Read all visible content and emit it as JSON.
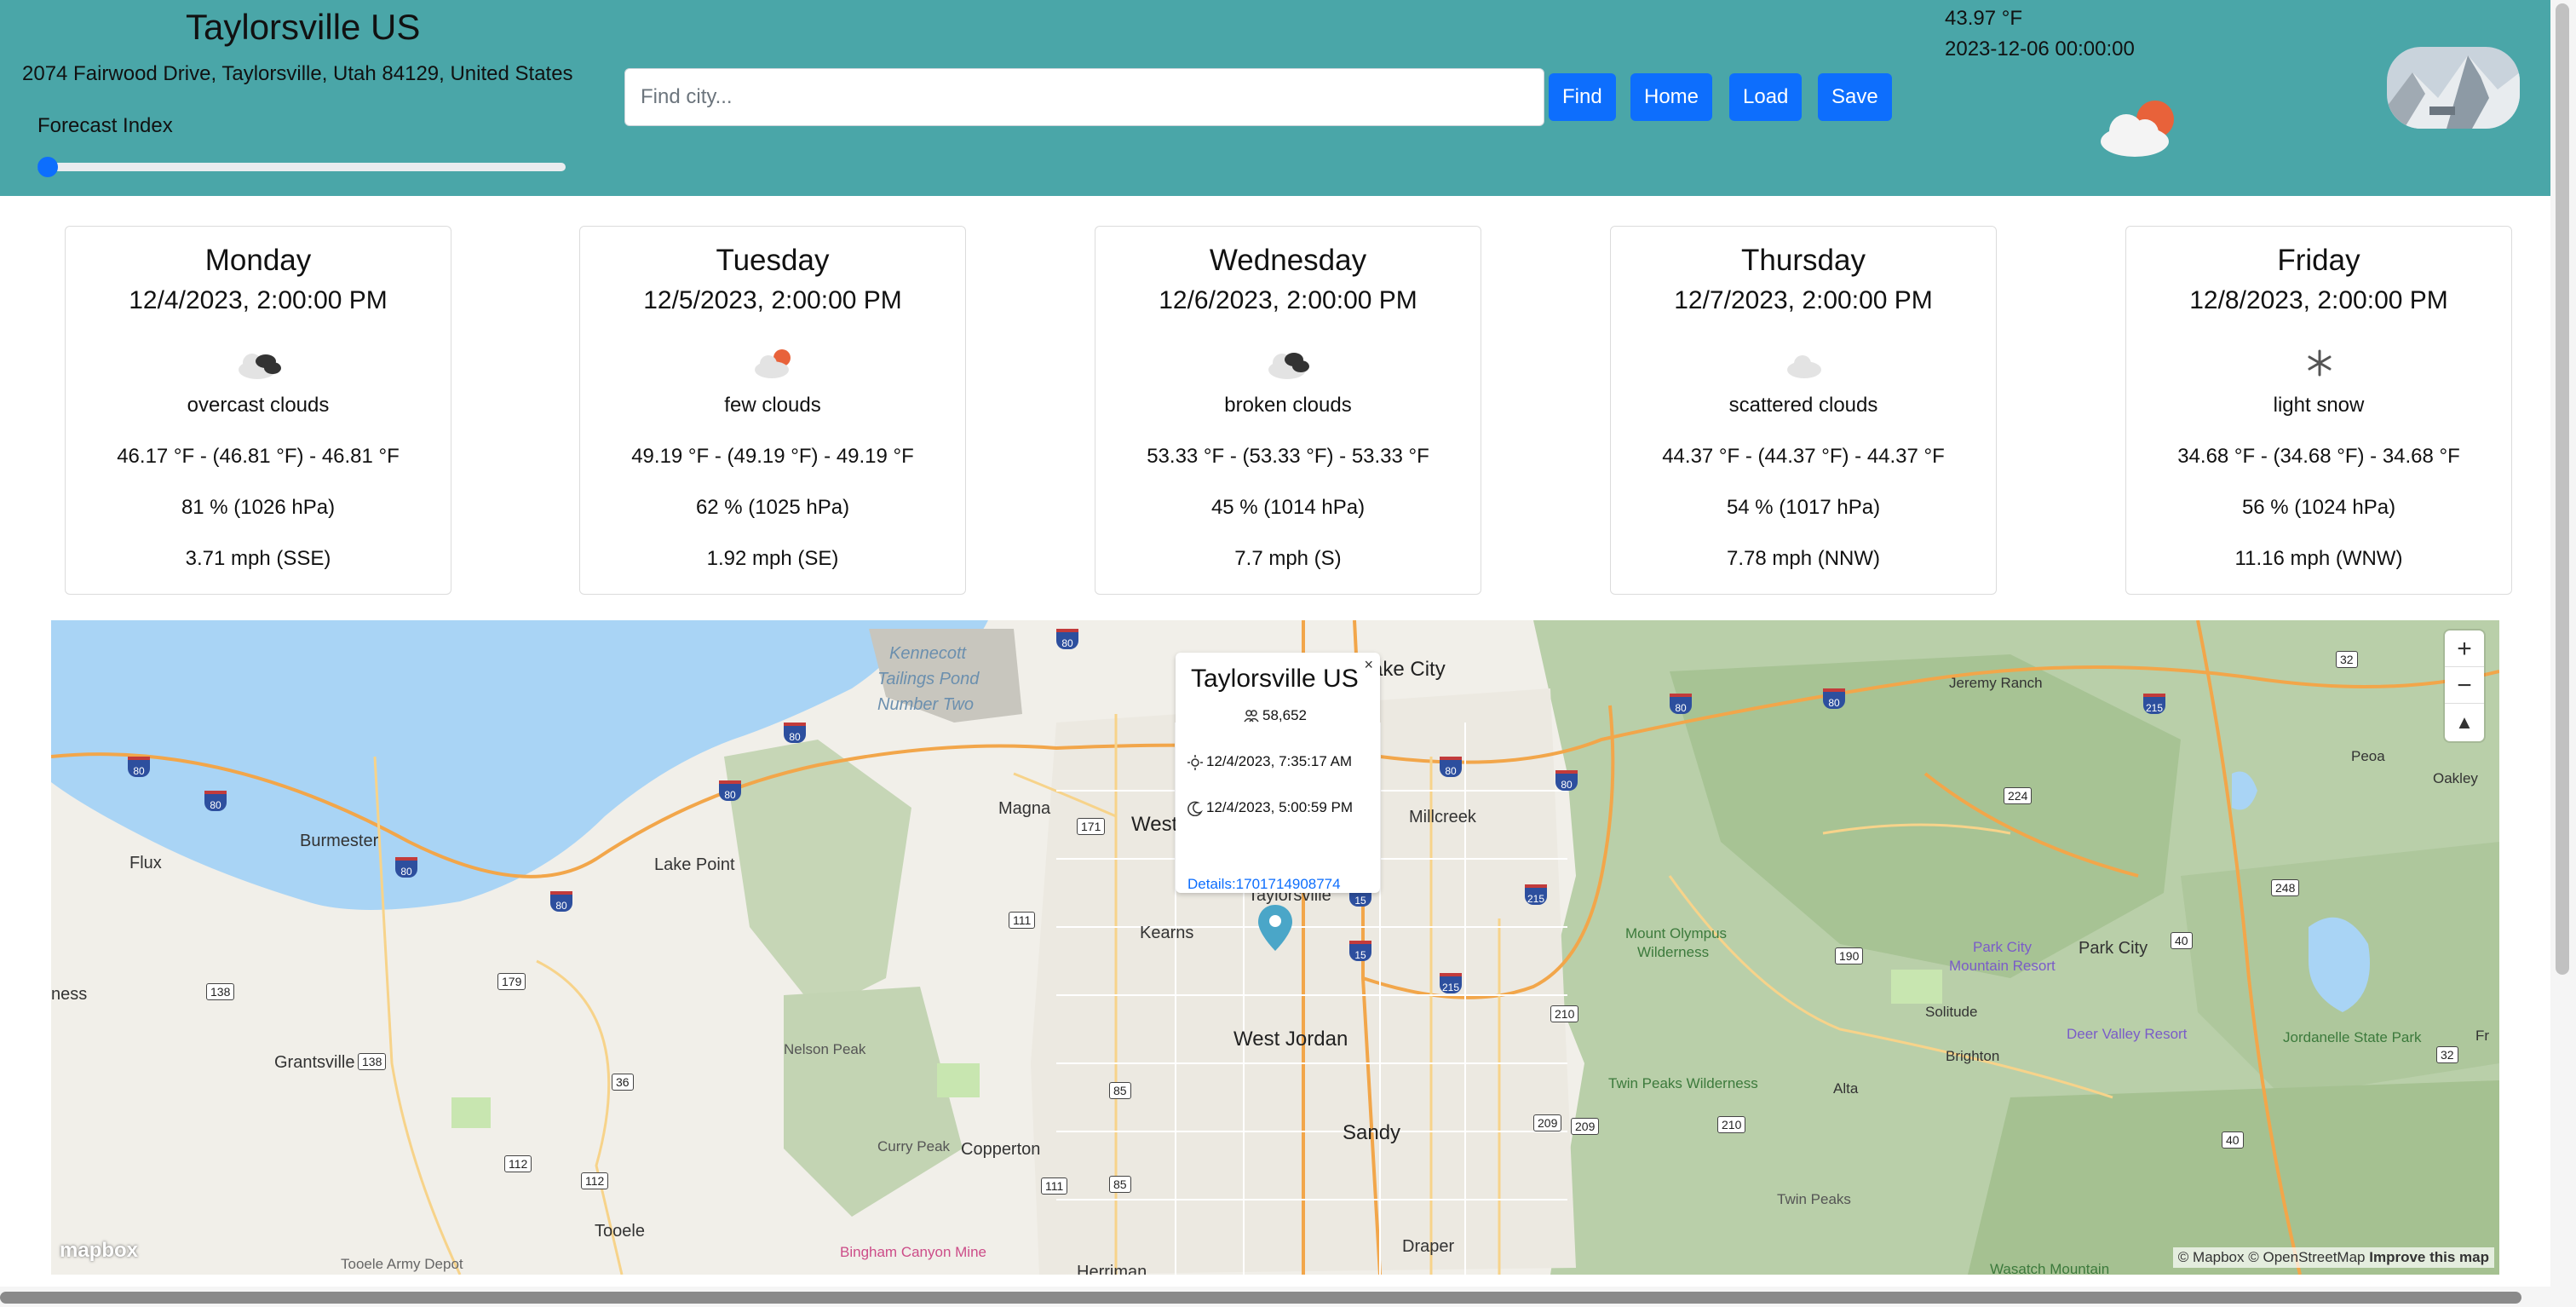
{
  "header": {
    "city_title": "Taylorsville US",
    "address": "2074 Fairwood Drive, Taylorsville, Utah 84129, United States",
    "forecast_index_label": "Forecast Index",
    "forecast_index_value": 0,
    "search_placeholder": "Find city...",
    "search_value": "",
    "buttons": {
      "find": "Find",
      "home": "Home",
      "load": "Load",
      "save": "Save"
    },
    "current_temp": "43.97 °F",
    "current_time": "2023-12-06 00:00:00",
    "current_icon": "few-clouds-icon",
    "background_color": "#4aa6a8"
  },
  "forecast": [
    {
      "day": "Monday",
      "date": "12/4/2023, 2:00:00 PM",
      "icon": "overcast-clouds-icon",
      "desc": "overcast clouds",
      "temp": "46.17 °F - (46.81 °F) - 46.81 °F",
      "humidity": "81 % (1026 hPa)",
      "wind": "3.71 mph (SSE)"
    },
    {
      "day": "Tuesday",
      "date": "12/5/2023, 2:00:00 PM",
      "icon": "few-clouds-icon",
      "desc": "few clouds",
      "temp": "49.19 °F - (49.19 °F) - 49.19 °F",
      "humidity": "62 % (1025 hPa)",
      "wind": "1.92 mph (SE)"
    },
    {
      "day": "Wednesday",
      "date": "12/6/2023, 2:00:00 PM",
      "icon": "broken-clouds-icon",
      "desc": "broken clouds",
      "temp": "53.33 °F - (53.33 °F) - 53.33 °F",
      "humidity": "45 % (1014 hPa)",
      "wind": "7.7 mph (S)"
    },
    {
      "day": "Thursday",
      "date": "12/7/2023, 2:00:00 PM",
      "icon": "scattered-clouds-icon",
      "desc": "scattered clouds",
      "temp": "44.37 °F - (44.37 °F) - 44.37 °F",
      "humidity": "54 % (1017 hPa)",
      "wind": "7.78 mph (NNW)"
    },
    {
      "day": "Friday",
      "date": "12/8/2023, 2:00:00 PM",
      "icon": "snowflake-icon",
      "desc": "light snow",
      "temp": "34.68 °F - (34.68 °F) - 34.68 °F",
      "humidity": "56 % (1024 hPa)",
      "wind": "11.16 mph (WNW)"
    }
  ],
  "map": {
    "popup": {
      "title": "Taylorsville US",
      "population": "58,652",
      "sunrise": "12/4/2023, 7:35:17 AM",
      "sunset": "12/4/2023, 5:00:59 PM",
      "details_link": "Details:1701714908774",
      "close": "×"
    },
    "zoom_in": "+",
    "zoom_out": "−",
    "compass": "▲",
    "logo": "mapbox",
    "attribution": "© Mapbox © OpenStreetMap",
    "improve": "Improve this map",
    "places": {
      "salt_lake_city": "ake City",
      "west_valley": "West",
      "magna": "Magna",
      "millcreek": "Millcreek",
      "taylorsville": "Taylorsville",
      "kearns": "Kearns",
      "west_jordan": "West Jordan",
      "sandy": "Sandy",
      "draper": "Draper",
      "herriman": "Herriman",
      "copperton": "Copperton",
      "grantsville": "Grantsville",
      "tooele": "Tooele",
      "tooele_army_depot": "Tooele Army Depot",
      "lake_point": "Lake Point",
      "burmester": "Burmester",
      "flux": "Flux",
      "ness": "ness",
      "nelson_peak": "Nelson Peak",
      "curry_peak": "Curry Peak",
      "bingham_mine": "Bingham Canyon Mine",
      "kennecott": "Kennecott",
      "tailings": "Tailings Pond",
      "number_two": "Number Two",
      "mount_olympus": "Mount Olympus",
      "wilderness": "Wilderness",
      "twin_peaks_wilderness": "Twin Peaks Wilderness",
      "twin_peaks": "Twin Peaks",
      "alta": "Alta",
      "brighton": "Brighton",
      "solitude": "Solitude",
      "park_city_resort": "Park City",
      "mountain_resort": "Mountain Resort",
      "park_city": "Park City",
      "deer_valley": "Deer Valley Resort",
      "jordanelle": "Jordanelle State Park",
      "jeremy_ranch": "Jeremy Ranch",
      "peoa": "Peoa",
      "oakley": "Oakley",
      "wasatch": "Wasatch Mountain",
      "fr": "Fr"
    },
    "shields": [
      "80",
      "80",
      "80",
      "80",
      "80",
      "80",
      "80",
      "80",
      "80",
      "80",
      "80",
      "215",
      "215",
      "215",
      "15",
      "15",
      "171",
      "111",
      "179",
      "138",
      "138",
      "112",
      "112",
      "36",
      "85",
      "85",
      "111",
      "209",
      "209",
      "210",
      "210",
      "190",
      "224",
      "248",
      "40",
      "40",
      "32",
      "32"
    ]
  }
}
